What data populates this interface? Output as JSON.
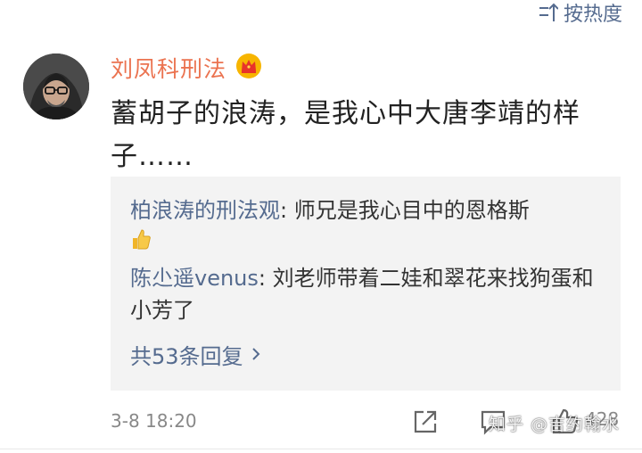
{
  "sort": {
    "label": "按热度"
  },
  "comment": {
    "username": "刘凤科刑法",
    "badge_icon": "crown-icon",
    "text": "蓄胡子的浪涛，是我心中大唐李靖的样子……",
    "timestamp": "3-8 18:20",
    "like_count": "428"
  },
  "replies": [
    {
      "name": "柏浪涛的刑法观",
      "text": ": 师兄是我心目中的恩格斯",
      "icon": "thumbs-up-icon"
    },
    {
      "name": "陈尐遥venus",
      "text": ": 刘老师带着二娃和翠花来找狗蛋和小芳了"
    }
  ],
  "more_replies": {
    "label": "共53条回复"
  },
  "watermark": "知乎 @吉约翰水",
  "colors": {
    "username": "#eb7350",
    "link": "#556b8f",
    "reply_bg": "#f3f3f3",
    "meta": "#888888"
  }
}
